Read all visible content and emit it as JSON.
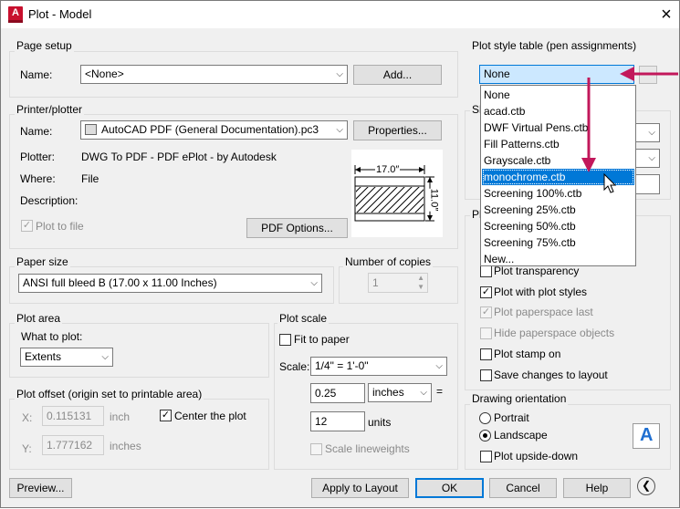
{
  "window": {
    "title": "Plot - Model",
    "app_icon_letter": "A"
  },
  "page_setup": {
    "group": "Page setup",
    "name_label": "Name:",
    "name_value": "<None>",
    "add_button": "Add..."
  },
  "printer": {
    "group": "Printer/plotter",
    "name_label": "Name:",
    "name_value": "AutoCAD PDF (General Documentation).pc3",
    "properties_button": "Properties...",
    "plotter_label": "Plotter:",
    "plotter_value": "DWG To PDF - PDF ePlot - by Autodesk",
    "where_label": "Where:",
    "where_value": "File",
    "description_label": "Description:",
    "plot_to_file": "Plot to file",
    "pdf_options_button": "PDF Options...",
    "preview_width_label": "17.0″",
    "preview_height_label": "11.0″"
  },
  "paper_size": {
    "group": "Paper size",
    "value": "ANSI full bleed B (17.00 x 11.00 Inches)"
  },
  "copies": {
    "group": "Number of copies",
    "value": "1"
  },
  "plot_area": {
    "group": "Plot area",
    "what_label": "What to plot:",
    "value": "Extents"
  },
  "plot_offset": {
    "group": "Plot offset (origin set to printable area)",
    "x_label": "X:",
    "x_value": "0.115131",
    "x_unit": "inch",
    "y_label": "Y:",
    "y_value": "1.777162",
    "y_unit": "inches",
    "center": "Center the plot"
  },
  "plot_scale": {
    "group": "Plot scale",
    "fit": "Fit to paper",
    "scale_label": "Scale:",
    "scale_value": "1/4\" = 1'-0\"",
    "value1": "0.25",
    "unit1": "inches",
    "equals": "=",
    "value2": "12",
    "unit2": "units",
    "lineweights": "Scale lineweights"
  },
  "plot_style": {
    "group": "Plot style table (pen assignments)",
    "value": "None",
    "options": [
      "None",
      "acad.ctb",
      "DWF Virtual Pens.ctb",
      "Fill Patterns.ctb",
      "Grayscale.ctb",
      "monochrome.ctb",
      "Screening 100%.ctb",
      "Screening 25%.ctb",
      "Screening 50%.ctb",
      "Screening 75%.ctb",
      "New..."
    ],
    "selected_index": 5
  },
  "hidden_labels": {
    "shaded_fragment": "Sh",
    "options_fragment": "Pl"
  },
  "plot_options": {
    "transparency": "Plot transparency",
    "with_styles": "Plot with plot styles",
    "paperspace_last": "Plot paperspace last",
    "hide_paperspace": "Hide paperspace objects",
    "stamp": "Plot stamp on",
    "save_changes": "Save changes to layout"
  },
  "orientation": {
    "group": "Drawing orientation",
    "portrait": "Portrait",
    "landscape": "Landscape",
    "upside_down": "Plot upside-down",
    "icon_letter": "A"
  },
  "footer": {
    "preview": "Preview...",
    "apply": "Apply to Layout",
    "ok": "OK",
    "cancel": "Cancel",
    "help": "Help"
  },
  "colors": {
    "accent": "#0078d7",
    "annotation": "#c2185b",
    "brand": "#c8102e"
  }
}
